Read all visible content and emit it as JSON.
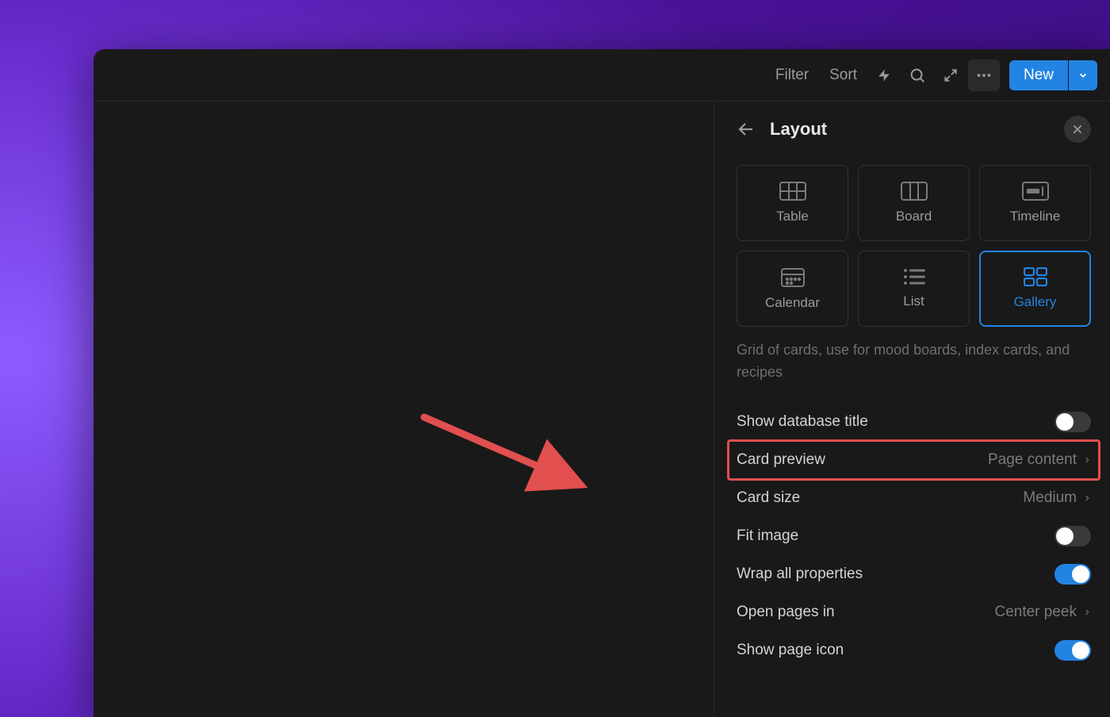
{
  "topbar": {
    "filter": "Filter",
    "sort": "Sort",
    "new": "New"
  },
  "panel": {
    "title": "Layout",
    "hint": "Grid of cards, use for mood boards, index cards, and recipes",
    "layouts": {
      "table": "Table",
      "board": "Board",
      "timeline": "Timeline",
      "calendar": "Calendar",
      "list": "List",
      "gallery": "Gallery"
    },
    "settings": {
      "show_db_title": {
        "label": "Show database title",
        "on": false
      },
      "card_preview": {
        "label": "Card preview",
        "value": "Page content"
      },
      "card_size": {
        "label": "Card size",
        "value": "Medium"
      },
      "fit_image": {
        "label": "Fit image",
        "on": false
      },
      "wrap_all": {
        "label": "Wrap all properties",
        "on": true
      },
      "open_pages": {
        "label": "Open pages in",
        "value": "Center peek"
      },
      "show_page_icon": {
        "label": "Show page icon",
        "on": true
      }
    }
  }
}
